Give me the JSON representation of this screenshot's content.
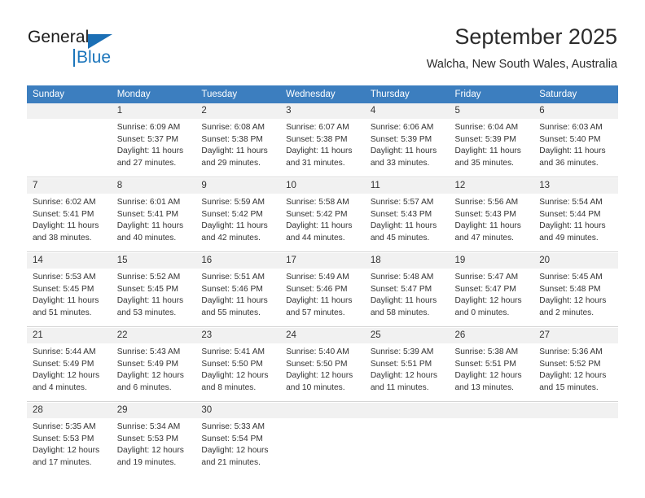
{
  "logo": {
    "word_one": "General",
    "word_two": "Blue",
    "triangle_color": "#1b6fb5",
    "blue_color": "#1b75bb"
  },
  "header": {
    "title": "September 2025",
    "location": "Walcha, New South Wales, Australia"
  },
  "theme": {
    "header_row_bg": "#3c7ebf",
    "daynum_band_bg": "#f1f1f1",
    "separator": "#d4d4d4",
    "text": "#333333"
  },
  "columns": [
    "Sunday",
    "Monday",
    "Tuesday",
    "Wednesday",
    "Thursday",
    "Friday",
    "Saturday"
  ],
  "weeks": [
    [
      {
        "day": "",
        "lines": []
      },
      {
        "day": "1",
        "lines": [
          "Sunrise: 6:09 AM",
          "Sunset: 5:37 PM",
          "Daylight: 11 hours",
          "and 27 minutes."
        ]
      },
      {
        "day": "2",
        "lines": [
          "Sunrise: 6:08 AM",
          "Sunset: 5:38 PM",
          "Daylight: 11 hours",
          "and 29 minutes."
        ]
      },
      {
        "day": "3",
        "lines": [
          "Sunrise: 6:07 AM",
          "Sunset: 5:38 PM",
          "Daylight: 11 hours",
          "and 31 minutes."
        ]
      },
      {
        "day": "4",
        "lines": [
          "Sunrise: 6:06 AM",
          "Sunset: 5:39 PM",
          "Daylight: 11 hours",
          "and 33 minutes."
        ]
      },
      {
        "day": "5",
        "lines": [
          "Sunrise: 6:04 AM",
          "Sunset: 5:39 PM",
          "Daylight: 11 hours",
          "and 35 minutes."
        ]
      },
      {
        "day": "6",
        "lines": [
          "Sunrise: 6:03 AM",
          "Sunset: 5:40 PM",
          "Daylight: 11 hours",
          "and 36 minutes."
        ]
      }
    ],
    [
      {
        "day": "7",
        "lines": [
          "Sunrise: 6:02 AM",
          "Sunset: 5:41 PM",
          "Daylight: 11 hours",
          "and 38 minutes."
        ]
      },
      {
        "day": "8",
        "lines": [
          "Sunrise: 6:01 AM",
          "Sunset: 5:41 PM",
          "Daylight: 11 hours",
          "and 40 minutes."
        ]
      },
      {
        "day": "9",
        "lines": [
          "Sunrise: 5:59 AM",
          "Sunset: 5:42 PM",
          "Daylight: 11 hours",
          "and 42 minutes."
        ]
      },
      {
        "day": "10",
        "lines": [
          "Sunrise: 5:58 AM",
          "Sunset: 5:42 PM",
          "Daylight: 11 hours",
          "and 44 minutes."
        ]
      },
      {
        "day": "11",
        "lines": [
          "Sunrise: 5:57 AM",
          "Sunset: 5:43 PM",
          "Daylight: 11 hours",
          "and 45 minutes."
        ]
      },
      {
        "day": "12",
        "lines": [
          "Sunrise: 5:56 AM",
          "Sunset: 5:43 PM",
          "Daylight: 11 hours",
          "and 47 minutes."
        ]
      },
      {
        "day": "13",
        "lines": [
          "Sunrise: 5:54 AM",
          "Sunset: 5:44 PM",
          "Daylight: 11 hours",
          "and 49 minutes."
        ]
      }
    ],
    [
      {
        "day": "14",
        "lines": [
          "Sunrise: 5:53 AM",
          "Sunset: 5:45 PM",
          "Daylight: 11 hours",
          "and 51 minutes."
        ]
      },
      {
        "day": "15",
        "lines": [
          "Sunrise: 5:52 AM",
          "Sunset: 5:45 PM",
          "Daylight: 11 hours",
          "and 53 minutes."
        ]
      },
      {
        "day": "16",
        "lines": [
          "Sunrise: 5:51 AM",
          "Sunset: 5:46 PM",
          "Daylight: 11 hours",
          "and 55 minutes."
        ]
      },
      {
        "day": "17",
        "lines": [
          "Sunrise: 5:49 AM",
          "Sunset: 5:46 PM",
          "Daylight: 11 hours",
          "and 57 minutes."
        ]
      },
      {
        "day": "18",
        "lines": [
          "Sunrise: 5:48 AM",
          "Sunset: 5:47 PM",
          "Daylight: 11 hours",
          "and 58 minutes."
        ]
      },
      {
        "day": "19",
        "lines": [
          "Sunrise: 5:47 AM",
          "Sunset: 5:47 PM",
          "Daylight: 12 hours",
          "and 0 minutes."
        ]
      },
      {
        "day": "20",
        "lines": [
          "Sunrise: 5:45 AM",
          "Sunset: 5:48 PM",
          "Daylight: 12 hours",
          "and 2 minutes."
        ]
      }
    ],
    [
      {
        "day": "21",
        "lines": [
          "Sunrise: 5:44 AM",
          "Sunset: 5:49 PM",
          "Daylight: 12 hours",
          "and 4 minutes."
        ]
      },
      {
        "day": "22",
        "lines": [
          "Sunrise: 5:43 AM",
          "Sunset: 5:49 PM",
          "Daylight: 12 hours",
          "and 6 minutes."
        ]
      },
      {
        "day": "23",
        "lines": [
          "Sunrise: 5:41 AM",
          "Sunset: 5:50 PM",
          "Daylight: 12 hours",
          "and 8 minutes."
        ]
      },
      {
        "day": "24",
        "lines": [
          "Sunrise: 5:40 AM",
          "Sunset: 5:50 PM",
          "Daylight: 12 hours",
          "and 10 minutes."
        ]
      },
      {
        "day": "25",
        "lines": [
          "Sunrise: 5:39 AM",
          "Sunset: 5:51 PM",
          "Daylight: 12 hours",
          "and 11 minutes."
        ]
      },
      {
        "day": "26",
        "lines": [
          "Sunrise: 5:38 AM",
          "Sunset: 5:51 PM",
          "Daylight: 12 hours",
          "and 13 minutes."
        ]
      },
      {
        "day": "27",
        "lines": [
          "Sunrise: 5:36 AM",
          "Sunset: 5:52 PM",
          "Daylight: 12 hours",
          "and 15 minutes."
        ]
      }
    ],
    [
      {
        "day": "28",
        "lines": [
          "Sunrise: 5:35 AM",
          "Sunset: 5:53 PM",
          "Daylight: 12 hours",
          "and 17 minutes."
        ]
      },
      {
        "day": "29",
        "lines": [
          "Sunrise: 5:34 AM",
          "Sunset: 5:53 PM",
          "Daylight: 12 hours",
          "and 19 minutes."
        ]
      },
      {
        "day": "30",
        "lines": [
          "Sunrise: 5:33 AM",
          "Sunset: 5:54 PM",
          "Daylight: 12 hours",
          "and 21 minutes."
        ]
      },
      {
        "day": "",
        "lines": []
      },
      {
        "day": "",
        "lines": []
      },
      {
        "day": "",
        "lines": []
      },
      {
        "day": "",
        "lines": []
      }
    ]
  ]
}
